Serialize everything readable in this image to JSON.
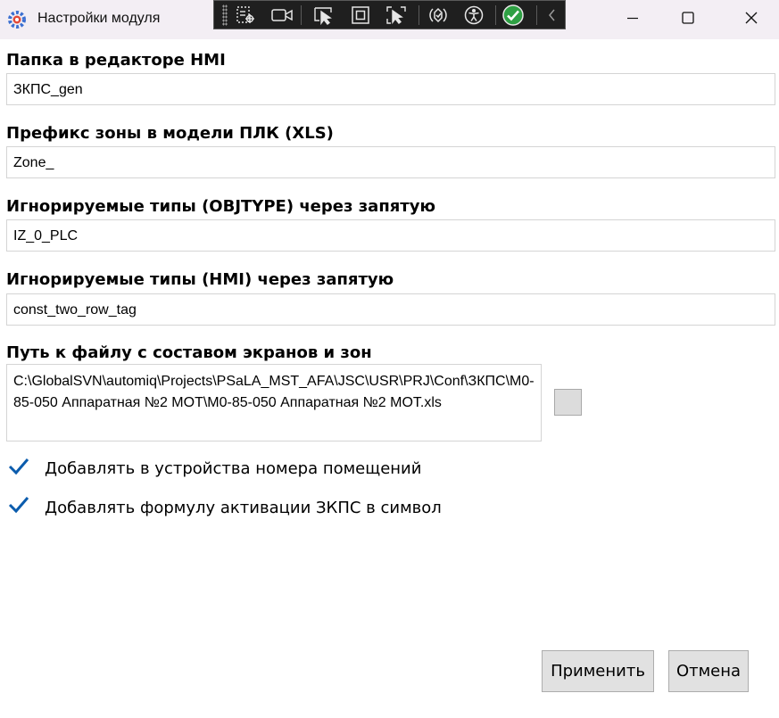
{
  "window": {
    "title": "Настройки модуля",
    "icons": {
      "app": "gear-icon",
      "minimize": "minimize-icon",
      "maximize": "maximize-icon",
      "close": "close-icon"
    }
  },
  "debug_toolbar": {
    "icons": [
      "grip-icon",
      "select-element-icon",
      "record-icon",
      "pointer-icon",
      "frame-icon",
      "track-focus-icon",
      "hot-reload-icon",
      "accessibility-icon",
      "status-ok-icon",
      "collapse-icon"
    ]
  },
  "form": {
    "hmi_folder": {
      "label": "Папка в редакторе HMI",
      "value": "ЗКПС_gen"
    },
    "zone_prefix": {
      "label": "Префикс зоны в модели ПЛК (XLS)",
      "value": "Zone_"
    },
    "ignored_objtype": {
      "label": "Игнорируемые типы (OBJTYPE) через запятую",
      "value": "IZ_0_PLC"
    },
    "ignored_hmi": {
      "label": "Игнорируемые типы (HMI) через запятую",
      "value": "const_two_row_tag"
    },
    "screens_file": {
      "label": "Путь к файлу с составом экранов и зон",
      "value": "C:\\GlobalSVN\\automiq\\Projects\\PSaLA_MST_AFA\\JSC\\USR\\PRJ\\Conf\\ЗКПС\\М0-85-050 Аппаратная №2 МОТ\\М0-85-050 Аппаратная №2 МОТ.xls"
    },
    "add_room_numbers": {
      "label": "Добавлять в устройства номера помещений",
      "checked": true
    },
    "add_activation_formula": {
      "label": "Добавлять формулу активации ЗКПС в символ",
      "checked": true
    }
  },
  "buttons": {
    "apply": "Применить",
    "cancel": "Отмена"
  },
  "colors": {
    "checkmark": "#0b5cad",
    "titlebar": "#f3eef4",
    "toolbar": "#1f1f1f",
    "status_ok": "#2ea043"
  }
}
